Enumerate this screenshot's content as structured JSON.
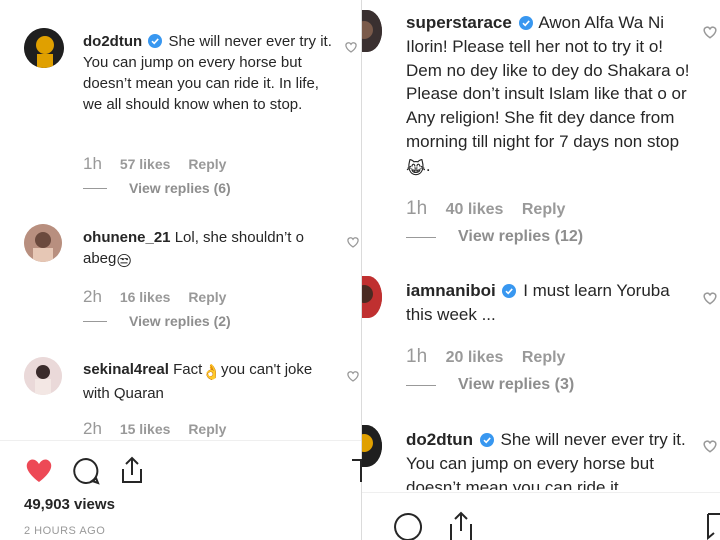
{
  "left": {
    "comments": [
      {
        "username": "do2dtun",
        "verified": true,
        "text": "She will never ever try it. You can jump on every horse but doesn’t mean you can ride it. In life, we all should know when to stop.",
        "time": "1h",
        "likes": "57 likes",
        "reply": "Reply",
        "view_replies": "View replies (6)"
      },
      {
        "username": "ohunene_21",
        "verified": false,
        "text": "Lol, she shouldn’t o abeg",
        "emoji": "😒",
        "time": "2h",
        "likes": "16 likes",
        "reply": "Reply",
        "view_replies": "View replies (2)"
      },
      {
        "username": "sekinal4real",
        "verified": false,
        "text_before": "Fact",
        "emoji": "👌",
        "text_after": "you can't joke with Quaran",
        "time": "2h",
        "likes": "15 likes",
        "reply": "Reply"
      }
    ],
    "views": "49,903 views",
    "posted_ago": "2 HOURS AGO"
  },
  "right": {
    "comments": [
      {
        "username": "superstarace",
        "verified": true,
        "text": "Awon Alfa Wa Ni Ilorin! Please tell her not to try it o! Dem no dey like to dey do Shakara o! Please don’t insult Islam like that o or Any religion! She fit dey dance from morning till night for 7 days non stop",
        "emoji": "😹",
        "time": "1h",
        "likes": "40 likes",
        "reply": "Reply",
        "view_replies": "View replies (12)"
      },
      {
        "username": "iamnaniboi",
        "verified": true,
        "text": "I must learn Yoruba this week ...",
        "time": "1h",
        "likes": "20 likes",
        "reply": "Reply",
        "view_replies": "View replies (3)"
      },
      {
        "username": "do2dtun",
        "verified": true,
        "text": "She will never ever try it. You can jump on every horse but doesn’t mean you can ride it."
      }
    ]
  },
  "colors": {
    "heart_filled": "#ed4956",
    "verified": "#3897f0",
    "meta_gray": "#999999"
  },
  "icons": [
    "heart-icon",
    "comment-icon",
    "share-icon",
    "bookmark-icon",
    "verified-badge-icon"
  ]
}
